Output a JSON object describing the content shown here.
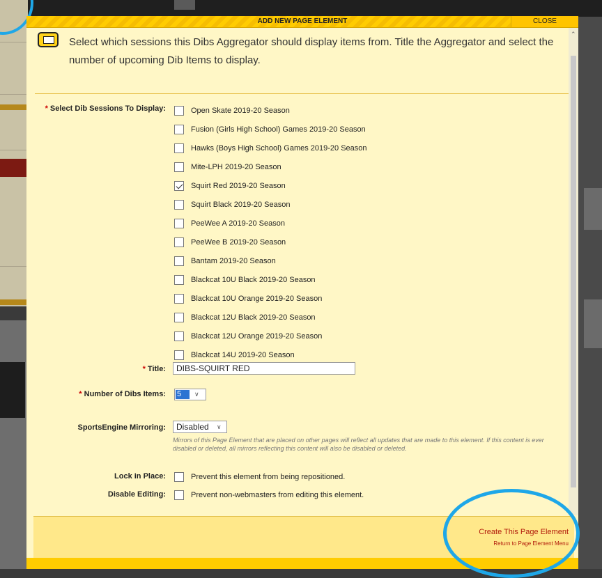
{
  "modal": {
    "title": "ADD NEW PAGE ELEMENT",
    "close_label": "CLOSE",
    "intro_text": "Select which sessions this Dibs Aggregator should display items from. Title the Aggregator and select the number of upcoming Dib Items to display."
  },
  "form": {
    "sessions_label": "Select Dib Sessions To Display:",
    "sessions": [
      {
        "label": "Open Skate 2019-20 Season",
        "checked": false
      },
      {
        "label": "Fusion (Girls High School) Games 2019-20 Season",
        "checked": false
      },
      {
        "label": "Hawks (Boys High School) Games 2019-20 Season",
        "checked": false
      },
      {
        "label": "Mite-LPH 2019-20 Season",
        "checked": false
      },
      {
        "label": "Squirt Red 2019-20 Season",
        "checked": true
      },
      {
        "label": "Squirt Black 2019-20 Season",
        "checked": false
      },
      {
        "label": "PeeWee A 2019-20 Season",
        "checked": false
      },
      {
        "label": "PeeWee B 2019-20 Season",
        "checked": false
      },
      {
        "label": "Bantam 2019-20 Season",
        "checked": false
      },
      {
        "label": "Blackcat 10U Black 2019-20 Season",
        "checked": false
      },
      {
        "label": "Blackcat 10U Orange 2019-20 Season",
        "checked": false
      },
      {
        "label": "Blackcat 12U Black 2019-20 Season",
        "checked": false
      },
      {
        "label": "Blackcat 12U Orange 2019-20 Season",
        "checked": false
      },
      {
        "label": "Blackcat 14U 2019-20 Season",
        "checked": false
      }
    ],
    "title_label": "Title:",
    "title_value": "DIBS-SQUIRT RED",
    "num_items_label": "Number of Dibs Items:",
    "num_items_value": "5",
    "mirroring_label": "SportsEngine Mirroring:",
    "mirroring_value": "Disabled",
    "mirroring_note": "Mirrors of this Page Element that are placed on other pages will reflect all updates that are made to this element. If this content is ever disabled or deleted, all mirrors reflecting this content will also be disabled or deleted.",
    "lock_label": "Lock in Place:",
    "lock_text": "Prevent this element from being repositioned.",
    "disable_label": "Disable Editing:",
    "disable_text": "Prevent non-webmasters from editing this element.",
    "required_mark": "*"
  },
  "footer": {
    "create_label": "Create This Page Element",
    "return_label": "Return to Page Element Menu"
  },
  "colors": {
    "modal_bg": "#fff7c6",
    "header_yellow": "#ffcc00",
    "link_red": "#b11a0a",
    "highlight_blue": "#1ea7e8"
  }
}
